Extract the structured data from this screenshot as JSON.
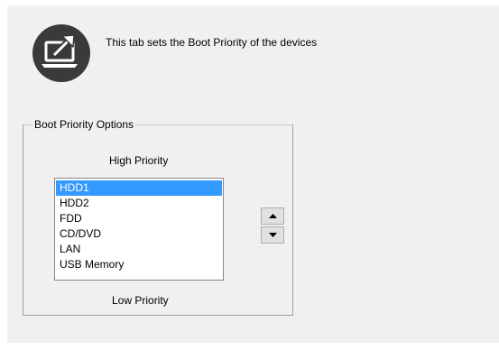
{
  "header": {
    "icon": "laptop-arrow-icon",
    "text": "This tab sets the Boot Priority of the devices"
  },
  "boot_priority": {
    "group_title": "Boot Priority Options",
    "high_label": "High Priority",
    "low_label": "Low Priority",
    "devices": [
      "HDD1",
      "HDD2",
      "FDD",
      "CD/DVD",
      "LAN",
      "USB Memory"
    ],
    "selected": "HDD1",
    "move_up_icon": "triangle-up-icon",
    "move_down_icon": "triangle-down-icon"
  },
  "colors": {
    "panel_background": "#f0f0f0",
    "icon_circle": "#3a3a3a",
    "selection": "#3399ff"
  }
}
